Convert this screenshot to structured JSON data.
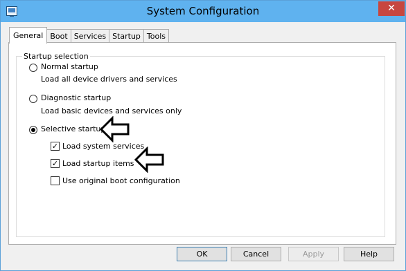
{
  "window": {
    "title": "System Configuration",
    "close_glyph": "✕"
  },
  "tabs": [
    {
      "label": "General",
      "active": true
    },
    {
      "label": "Boot"
    },
    {
      "label": "Services"
    },
    {
      "label": "Startup"
    },
    {
      "label": "Tools"
    }
  ],
  "startup_selection": {
    "group_label": "Startup selection",
    "normal": {
      "label": "Normal startup",
      "description": "Load all device drivers and services",
      "selected": false
    },
    "diagnostic": {
      "label": "Diagnostic startup",
      "description": "Load basic devices and services only",
      "selected": false
    },
    "selective": {
      "label": "Selective startup",
      "selected": true
    },
    "options": {
      "system_services": {
        "label": "Load system services",
        "checked": true
      },
      "startup_items": {
        "label": "Load startup items",
        "checked": true
      },
      "original_boot": {
        "label": "Use original boot configuration",
        "checked": false
      }
    },
    "check_glyph": "✓"
  },
  "buttons": {
    "ok": "OK",
    "cancel": "Cancel",
    "apply": "Apply",
    "help": "Help"
  },
  "colors": {
    "titlebar": "#5fb2ef",
    "close": "#c7463f"
  }
}
